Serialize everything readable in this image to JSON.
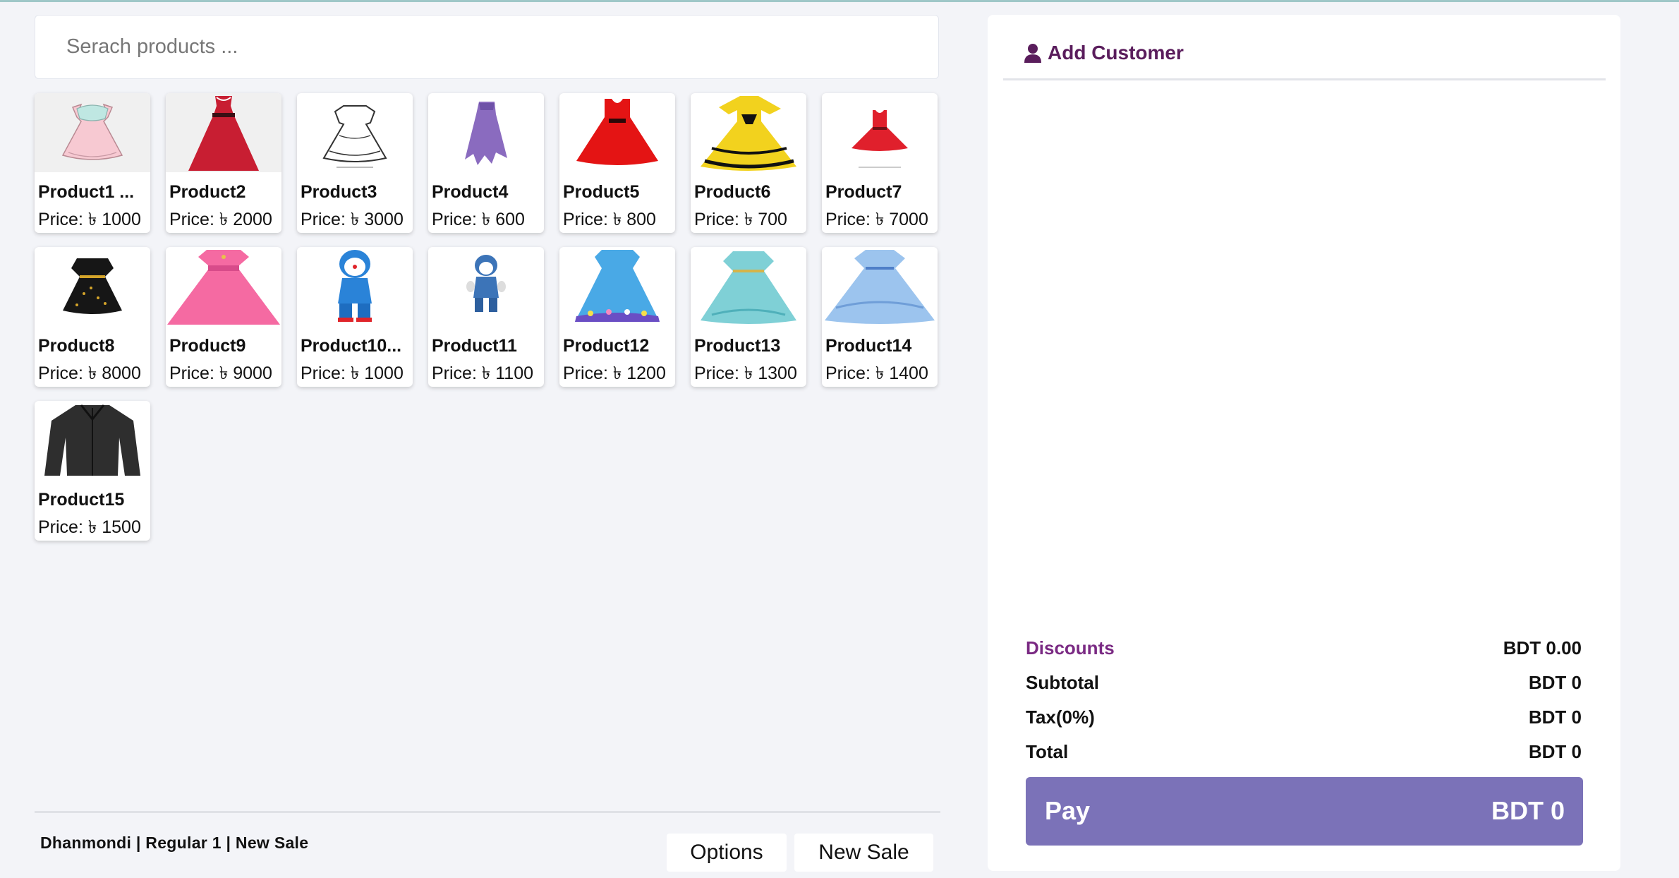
{
  "search": {
    "placeholder": "Serach products ..."
  },
  "products": [
    {
      "name": "Product1 ...",
      "price": "Price: ৳ 1000",
      "image": "pink-dress-sketch"
    },
    {
      "name": "Product2",
      "price": "Price: ৳ 2000",
      "image": "red-gown"
    },
    {
      "name": "Product3",
      "price": "Price: ৳ 3000",
      "image": "white-dress-outline"
    },
    {
      "name": "Product4",
      "price": "Price: ৳ 600",
      "image": "purple-dress"
    },
    {
      "name": "Product5",
      "price": "Price: ৳ 800",
      "image": "red-dress"
    },
    {
      "name": "Product6",
      "price": "Price: ৳ 700",
      "image": "yellow-frilled-dress"
    },
    {
      "name": "Product7",
      "price": "Price: ৳ 7000",
      "image": "small-red-dress"
    },
    {
      "name": "Product8",
      "price": "Price: ৳ 8000",
      "image": "black-dress"
    },
    {
      "name": "Product9",
      "price": "Price: ৳ 9000",
      "image": "pink-ball-gown"
    },
    {
      "name": "Product10...",
      "price": "Price: ৳ 1000",
      "image": "blue-cartoon-costume"
    },
    {
      "name": "Product11",
      "price": "Price: ৳ 1100",
      "image": "cartoon-costume"
    },
    {
      "name": "Product12",
      "price": "Price: ৳ 1200",
      "image": "blue-print-dress"
    },
    {
      "name": "Product13",
      "price": "Price: ৳ 1300",
      "image": "teal-princess-dress"
    },
    {
      "name": "Product14",
      "price": "Price: ৳ 1400",
      "image": "light-blue-princess-dress"
    },
    {
      "name": "Product15",
      "price": "Price: ৳ 1500",
      "image": "black-jacket"
    }
  ],
  "footer": {
    "status": "Dhanmondi | Regular 1 | New Sale",
    "options_label": "Options",
    "new_sale_label": "New Sale"
  },
  "customer": {
    "add_label": "Add Customer",
    "icon": "user-icon"
  },
  "summary": {
    "discounts_label": "Discounts",
    "discounts_value": "BDT 0.00",
    "subtotal_label": "Subtotal",
    "subtotal_value": "BDT 0",
    "tax_label": "Tax(0%)",
    "tax_value": "BDT 0",
    "total_label": "Total",
    "total_value": "BDT 0"
  },
  "pay": {
    "label": "Pay",
    "amount": "BDT 0"
  },
  "colors": {
    "accent": "#5a1d5c",
    "pay": "#7b72b8",
    "discount": "#7a2a83",
    "background": "#f3f4f8"
  }
}
